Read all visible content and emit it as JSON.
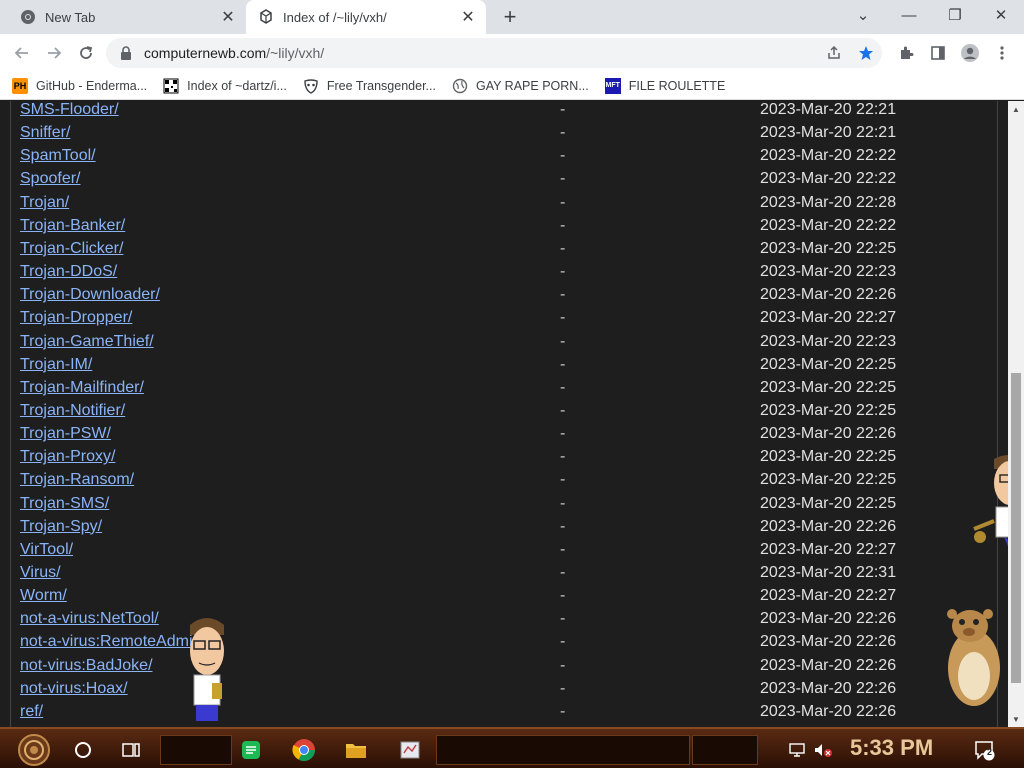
{
  "tabs": [
    {
      "title": "New Tab",
      "icon": "chrome-icon",
      "active": false
    },
    {
      "title": "Index of /~lily/vxh/",
      "icon": "page-icon",
      "active": true
    }
  ],
  "window_controls": {
    "tab_search": "⌄",
    "minimize": "—",
    "restore": "❐",
    "close": "✕"
  },
  "toolbar": {
    "url_host": "computernewb.com",
    "url_path": "/~lily/vxh/"
  },
  "bookmarks": [
    {
      "label": "GitHub - Enderma...",
      "icon": "ph-icon"
    },
    {
      "label": "Index of ~dartz/i...",
      "icon": "qr-icon"
    },
    {
      "label": "Free Transgender...",
      "icon": "mask-icon"
    },
    {
      "label": "GAY RAPE PORN...",
      "icon": "globe-icon"
    },
    {
      "label": "FILE ROULETTE",
      "icon": "mft-icon"
    }
  ],
  "listing": [
    {
      "name": "SMS-Flooder/",
      "size": "-",
      "date": "2023-Mar-20 22:21"
    },
    {
      "name": "Sniffer/",
      "size": "-",
      "date": "2023-Mar-20 22:21"
    },
    {
      "name": "SpamTool/",
      "size": "-",
      "date": "2023-Mar-20 22:22"
    },
    {
      "name": "Spoofer/",
      "size": "-",
      "date": "2023-Mar-20 22:22"
    },
    {
      "name": "Trojan/",
      "size": "-",
      "date": "2023-Mar-20 22:28"
    },
    {
      "name": "Trojan-Banker/",
      "size": "-",
      "date": "2023-Mar-20 22:22"
    },
    {
      "name": "Trojan-Clicker/",
      "size": "-",
      "date": "2023-Mar-20 22:25"
    },
    {
      "name": "Trojan-DDoS/",
      "size": "-",
      "date": "2023-Mar-20 22:23"
    },
    {
      "name": "Trojan-Downloader/",
      "size": "-",
      "date": "2023-Mar-20 22:26"
    },
    {
      "name": "Trojan-Dropper/",
      "size": "-",
      "date": "2023-Mar-20 22:27"
    },
    {
      "name": "Trojan-GameThief/",
      "size": "-",
      "date": "2023-Mar-20 22:23"
    },
    {
      "name": "Trojan-IM/",
      "size": "-",
      "date": "2023-Mar-20 22:25"
    },
    {
      "name": "Trojan-Mailfinder/",
      "size": "-",
      "date": "2023-Mar-20 22:25"
    },
    {
      "name": "Trojan-Notifier/",
      "size": "-",
      "date": "2023-Mar-20 22:25"
    },
    {
      "name": "Trojan-PSW/",
      "size": "-",
      "date": "2023-Mar-20 22:26"
    },
    {
      "name": "Trojan-Proxy/",
      "size": "-",
      "date": "2023-Mar-20 22:25"
    },
    {
      "name": "Trojan-Ransom/",
      "size": "-",
      "date": "2023-Mar-20 22:25"
    },
    {
      "name": "Trojan-SMS/",
      "size": "-",
      "date": "2023-Mar-20 22:25"
    },
    {
      "name": "Trojan-Spy/",
      "size": "-",
      "date": "2023-Mar-20 22:26"
    },
    {
      "name": "VirTool/",
      "size": "-",
      "date": "2023-Mar-20 22:27"
    },
    {
      "name": "Virus/",
      "size": "-",
      "date": "2023-Mar-20 22:31"
    },
    {
      "name": "Worm/",
      "size": "-",
      "date": "2023-Mar-20 22:27"
    },
    {
      "name": "not-a-virus:NetTool/",
      "size": "-",
      "date": "2023-Mar-20 22:26"
    },
    {
      "name": "not-a-virus:RemoteAdmin/",
      "size": "-",
      "date": "2023-Mar-20 22:26"
    },
    {
      "name": "not-virus:BadJoke/",
      "size": "-",
      "date": "2023-Mar-20 22:26"
    },
    {
      "name": "not-virus:Hoax/",
      "size": "-",
      "date": "2023-Mar-20 22:26"
    },
    {
      "name": "ref/",
      "size": "-",
      "date": "2023-Mar-20 22:26"
    }
  ],
  "taskbar": {
    "clock": "5:33 PM",
    "notification_count": "2",
    "apps": [
      "start-orb-icon",
      "cortana-icon",
      "task-view-icon",
      "notes-icon",
      "chrome-icon",
      "file-explorer-icon",
      "paint-icon"
    ]
  },
  "colors": {
    "link": "#8ab4f8",
    "background": "#1e1e1e",
    "taskbar": "#3a1608"
  }
}
